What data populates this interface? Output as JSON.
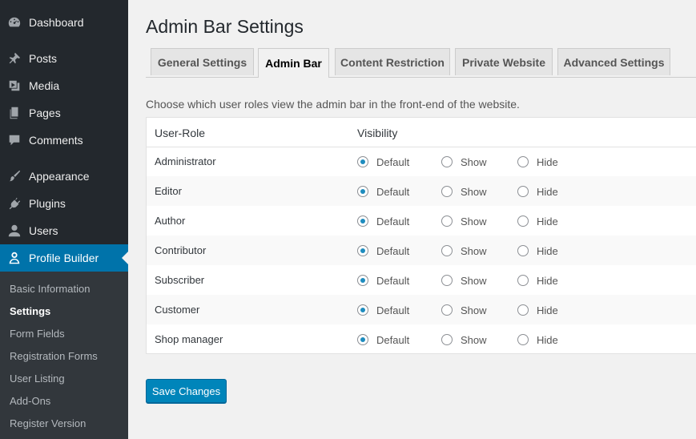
{
  "sidebar": {
    "items": [
      {
        "label": "Dashboard",
        "icon": "dashboard-icon"
      },
      {
        "label": "Posts",
        "icon": "pin-icon"
      },
      {
        "label": "Media",
        "icon": "media-icon"
      },
      {
        "label": "Pages",
        "icon": "pages-icon"
      },
      {
        "label": "Comments",
        "icon": "comment-icon"
      },
      {
        "label": "Appearance",
        "icon": "paintbrush-icon"
      },
      {
        "label": "Plugins",
        "icon": "plugin-icon"
      },
      {
        "label": "Users",
        "icon": "users-icon"
      },
      {
        "label": "Profile Builder",
        "icon": "user-icon"
      }
    ],
    "submenu": [
      {
        "label": "Basic Information"
      },
      {
        "label": "Settings"
      },
      {
        "label": "Form Fields"
      },
      {
        "label": "Registration Forms"
      },
      {
        "label": "User Listing"
      },
      {
        "label": "Add-Ons"
      },
      {
        "label": "Register Version"
      }
    ],
    "accent_color": "#0073aa"
  },
  "page": {
    "title": "Admin Bar Settings",
    "tabs": [
      {
        "label": "General Settings"
      },
      {
        "label": "Admin Bar"
      },
      {
        "label": "Content Restriction"
      },
      {
        "label": "Private Website"
      },
      {
        "label": "Advanced Settings"
      }
    ],
    "active_tab": "Admin Bar",
    "description": "Choose which user roles view the admin bar in the front-end of the website."
  },
  "table": {
    "headers": [
      "User-Role",
      "Visibility"
    ],
    "options": [
      "Default",
      "Show",
      "Hide"
    ],
    "rows": [
      {
        "role": "Administrator",
        "selected": "Default"
      },
      {
        "role": "Editor",
        "selected": "Default"
      },
      {
        "role": "Author",
        "selected": "Default"
      },
      {
        "role": "Contributor",
        "selected": "Default"
      },
      {
        "role": "Subscriber",
        "selected": "Default"
      },
      {
        "role": "Customer",
        "selected": "Default"
      },
      {
        "role": "Shop manager",
        "selected": "Default"
      }
    ]
  },
  "actions": {
    "save_label": "Save Changes",
    "save_color": "#0085ba"
  }
}
